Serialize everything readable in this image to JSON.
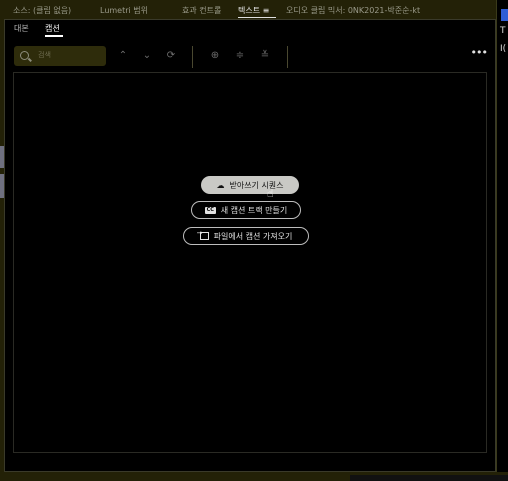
{
  "tabs": [
    {
      "label": "소스: (클립 없음)"
    },
    {
      "label": "Lumetri 범위"
    },
    {
      "label": "효과 컨트롤"
    },
    {
      "label": "텍스트 ≡"
    },
    {
      "label": "오디오 클립 믹서: 0NK2021-박준순-kt"
    }
  ],
  "subtabs": [
    {
      "label": "대본"
    },
    {
      "label": "캡션"
    }
  ],
  "search": {
    "placeholder": "검색"
  },
  "toolbar": {
    "more": "•••"
  },
  "actions": {
    "transcribe_label": "받아쓰기 시퀀스",
    "new_track_label": "새 캡션 트랙 만들기",
    "import_label": "파일에서 캡션 가져오기"
  },
  "right_panel": {
    "g1": "T",
    "g2": "I("
  }
}
